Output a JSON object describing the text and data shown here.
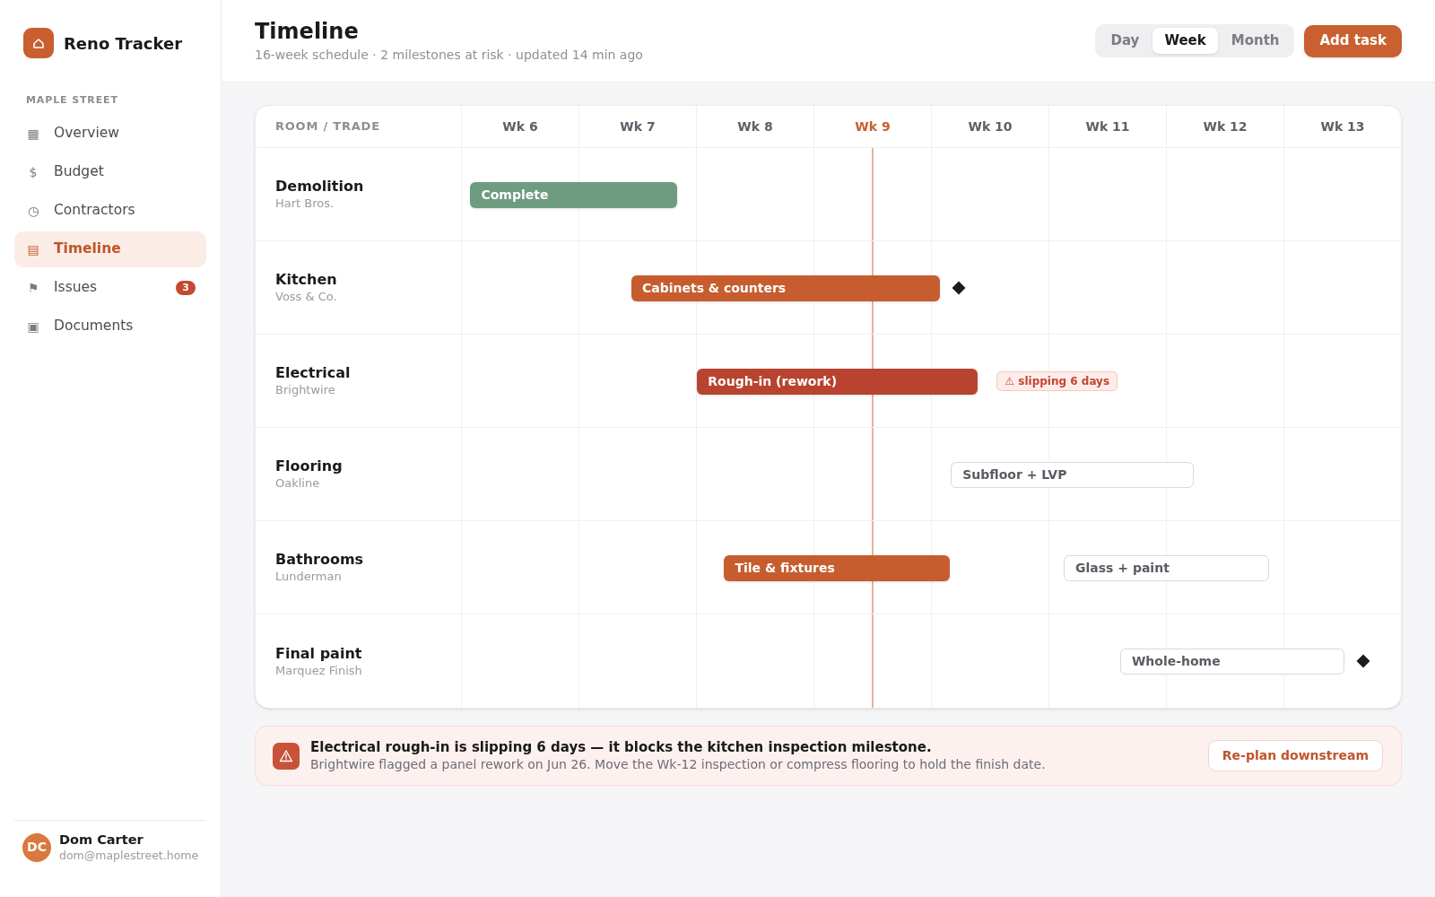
{
  "sidebar": {
    "app_name": "Reno Tracker",
    "section": "MAPLE STREET",
    "items": [
      {
        "icon": "▦",
        "label": "Overview",
        "selected": false
      },
      {
        "icon": "$",
        "label": "Budget",
        "selected": false
      },
      {
        "icon": "◷",
        "label": "Contractors",
        "selected": false
      },
      {
        "icon": "▤",
        "label": "Timeline",
        "selected": true
      },
      {
        "icon": "⚑",
        "label": "Issues",
        "selected": false,
        "badge": "3"
      },
      {
        "icon": "▣",
        "label": "Documents",
        "selected": false
      }
    ],
    "user": {
      "initials": "DC",
      "name": "Dom Carter",
      "email": "dom@maplestreet.home"
    }
  },
  "header": {
    "title": "Timeline",
    "subtitle": "16-week schedule · 2 milestones at risk · updated 14 min ago",
    "view_tabs": [
      {
        "label": "Day",
        "selected": false
      },
      {
        "label": "Week",
        "selected": true
      },
      {
        "label": "Month",
        "selected": false
      }
    ],
    "add_button": "Add task"
  },
  "timeline": {
    "corner_label": "ROOM / TRADE",
    "weeks": [
      {
        "label": "Wk 6",
        "current": false
      },
      {
        "label": "Wk 7",
        "current": false
      },
      {
        "label": "Wk 8",
        "current": false
      },
      {
        "label": "Wk 9",
        "current": true
      },
      {
        "label": "Wk 10",
        "current": false
      },
      {
        "label": "Wk 11",
        "current": false
      },
      {
        "label": "Wk 12",
        "current": false
      },
      {
        "label": "Wk 13",
        "current": false
      }
    ],
    "rows": [
      {
        "name": "Demolition",
        "contractor": "Hart Bros.",
        "milestone": false,
        "tasks": [
          {
            "label": "Complete",
            "kind": "complete"
          }
        ]
      },
      {
        "name": "Kitchen",
        "contractor": "Voss & Co.",
        "milestone": true,
        "tasks": [
          {
            "label": "Cabinets & counters",
            "kind": "active"
          }
        ]
      },
      {
        "name": "Electrical",
        "contractor": "Brightwire",
        "milestone": false,
        "tasks": [
          {
            "label": "Rough-in (rework)",
            "kind": "at-risk"
          }
        ],
        "flag": "⚠ slipping 6 days"
      },
      {
        "name": "Flooring",
        "contractor": "Oakline",
        "milestone": false,
        "tasks": [
          {
            "label": "Subfloor + LVP",
            "kind": "planned"
          }
        ]
      },
      {
        "name": "Bathrooms",
        "contractor": "Lunderman",
        "milestone": false,
        "tasks": [
          {
            "label": "Tile & fixtures",
            "kind": "active"
          },
          {
            "label": "Glass + paint",
            "kind": "planned"
          }
        ]
      },
      {
        "name": "Final paint",
        "contractor": "Marquez Finish",
        "milestone": true,
        "tasks": [
          {
            "label": "Whole-home",
            "kind": "planned"
          }
        ]
      }
    ]
  },
  "alert": {
    "title": "Electrical rough-in is slipping 6 days — it blocks the kitchen inspection milestone.",
    "body": "Brightwire flagged a panel rework on Jun 26. Move the Wk-12 inspection or compress flooring to hold the finish date.",
    "button": "Re-plan downstream"
  }
}
